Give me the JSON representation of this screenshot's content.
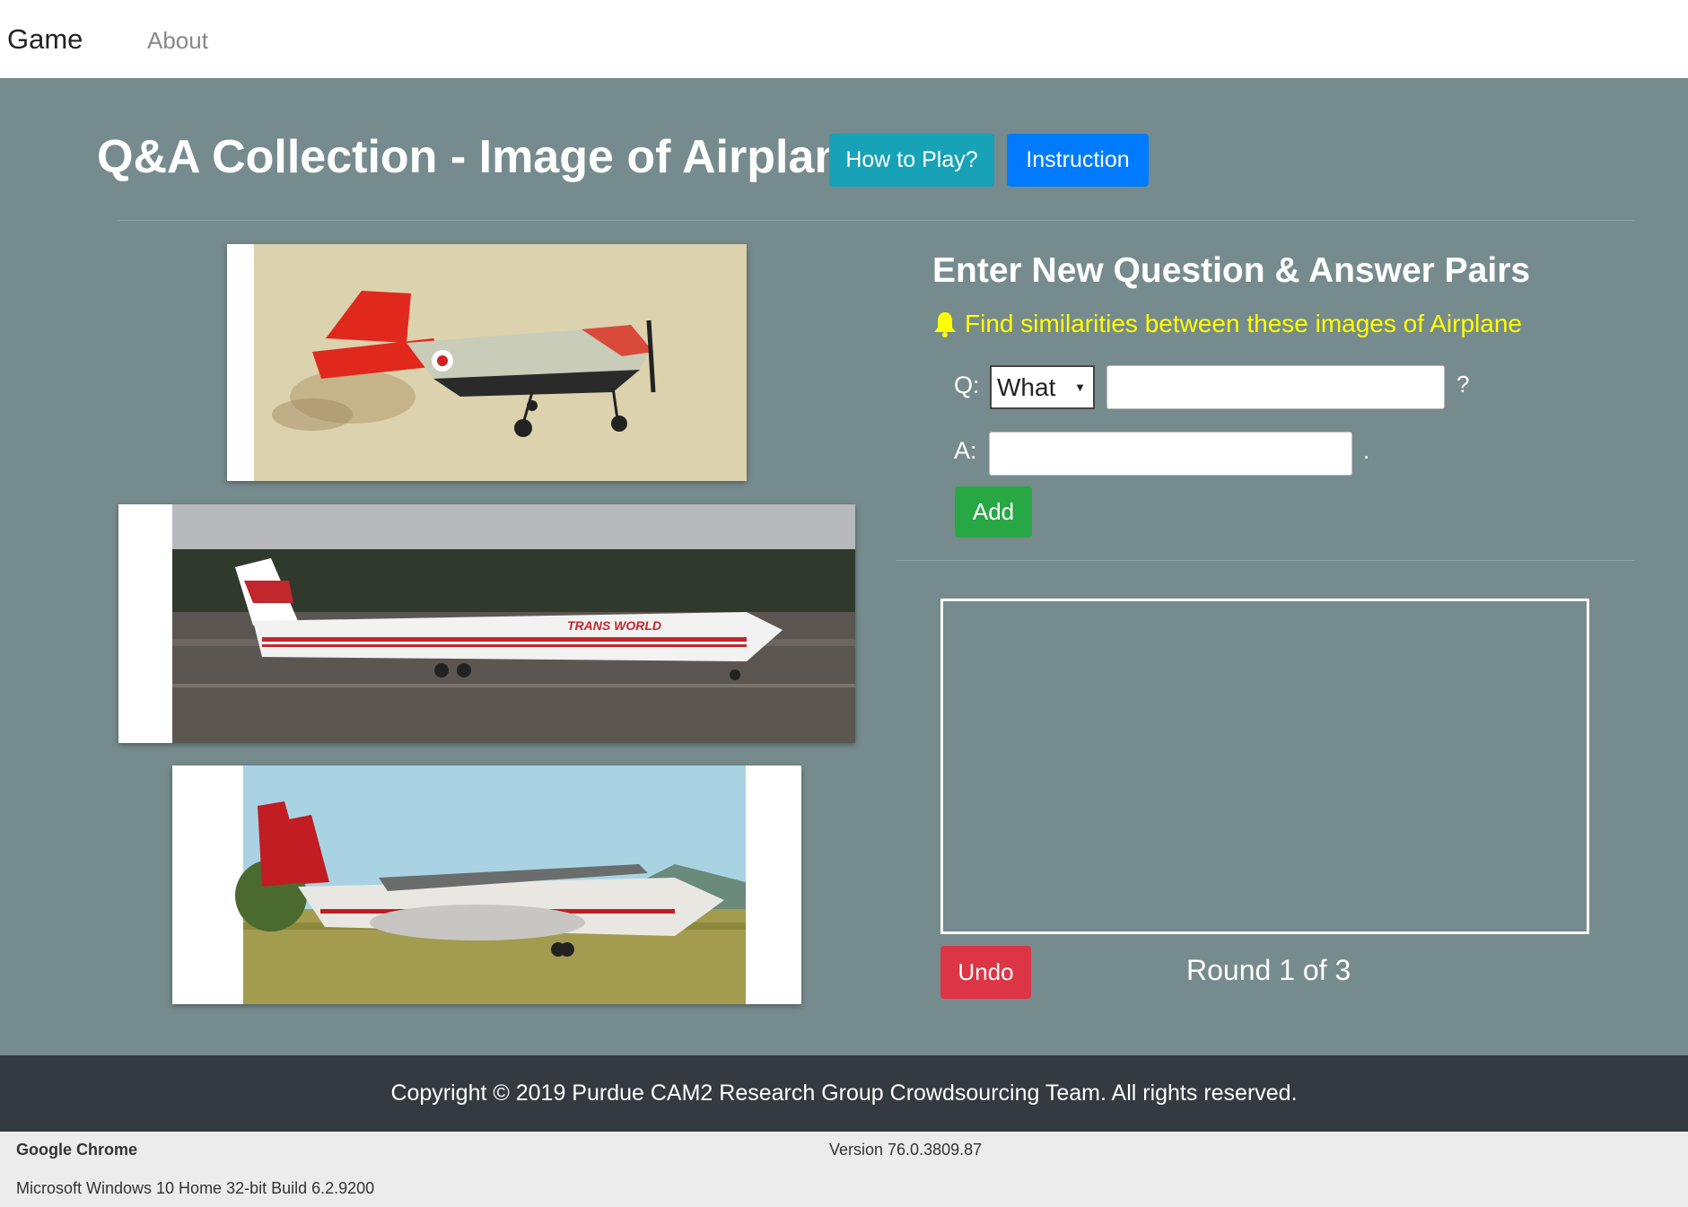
{
  "navbar": {
    "brand": "Game",
    "about": "About"
  },
  "header": {
    "title": "Q&A Collection - Image of Airplane",
    "how_to_play": "How to Play?",
    "instruction": "Instruction"
  },
  "images": [
    {
      "name": "red-trainer-airplane",
      "background": "#d9cfa8"
    },
    {
      "name": "twa-jet-airliner",
      "background": "#6e6a66"
    },
    {
      "name": "cargo-airplane-on-grass",
      "background": "#a9d3e3"
    }
  ],
  "form": {
    "heading": "Enter New Question & Answer Pairs",
    "hint": "Find similarities between these images of Airplane",
    "q_label": "Q:",
    "q_word": "What",
    "q_suffix": "?",
    "a_label": "A:",
    "a_suffix": ".",
    "add": "Add"
  },
  "results": {
    "undo": "Undo",
    "round": "Round 1 of 3"
  },
  "footer": {
    "copyright": "Copyright © 2019 Purdue CAM2 Research Group Crowdsourcing Team. All rights reserved."
  },
  "system": {
    "app": "Google Chrome",
    "version": "Version 76.0.3809.87",
    "os": "Microsoft Windows 10 Home 32-bit Build 6.2.9200"
  },
  "colors": {
    "page_bg": "#768b8d",
    "info": "#17a2b8",
    "primary": "#007bff",
    "success": "#28a745",
    "danger": "#dc3545",
    "hint": "#ffff00",
    "footer_bg": "#343a40"
  }
}
